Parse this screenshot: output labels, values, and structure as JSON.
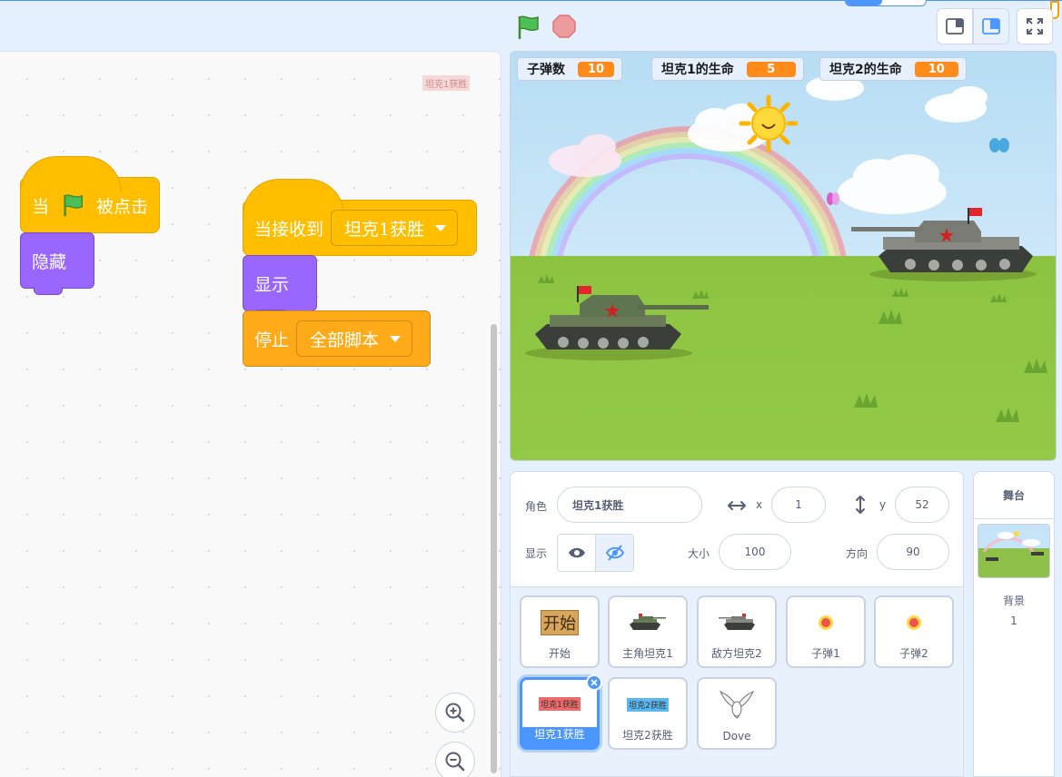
{
  "code": {
    "watermark": "坦克1获胜",
    "script1": {
      "when": "当",
      "clicked": "被点击",
      "hide": "隐藏"
    },
    "script2": {
      "receive": "当接收到",
      "message": "坦克1获胜",
      "show": "显示",
      "stop": "停止",
      "stop_option": "全部脚本"
    }
  },
  "monitors": [
    {
      "label": "子弹数",
      "value": "10"
    },
    {
      "label": "坦克1的生命",
      "value": "5"
    },
    {
      "label": "坦克2的生命",
      "value": "10"
    }
  ],
  "sprite_info": {
    "sprite_label": "角色",
    "sprite_name": "坦克1获胜",
    "x_label": "x",
    "x_value": "1",
    "y_label": "y",
    "y_value": "52",
    "show_label": "显示",
    "size_label": "大小",
    "size_value": "100",
    "direction_label": "方向",
    "direction_value": "90"
  },
  "sprites": [
    {
      "name": "开始",
      "thumb_text": "开始"
    },
    {
      "name": "主角坦克1"
    },
    {
      "name": "敌方坦克2"
    },
    {
      "name": "子弹1"
    },
    {
      "name": "子弹2"
    },
    {
      "name": "坦克1获胜",
      "thumb_text": "坦克1获胜"
    },
    {
      "name": "坦克2获胜",
      "thumb_text": "坦克2获胜"
    },
    {
      "name": "Dove"
    }
  ],
  "stage_pane": {
    "title": "舞台",
    "backdrops_label": "背景",
    "backdrops_count": "1"
  },
  "colors": {
    "events": "#ffbf00",
    "looks": "#9966ff",
    "control": "#ffab19",
    "accent": "#4c97ff",
    "monitor_value": "#ff8c1a"
  }
}
